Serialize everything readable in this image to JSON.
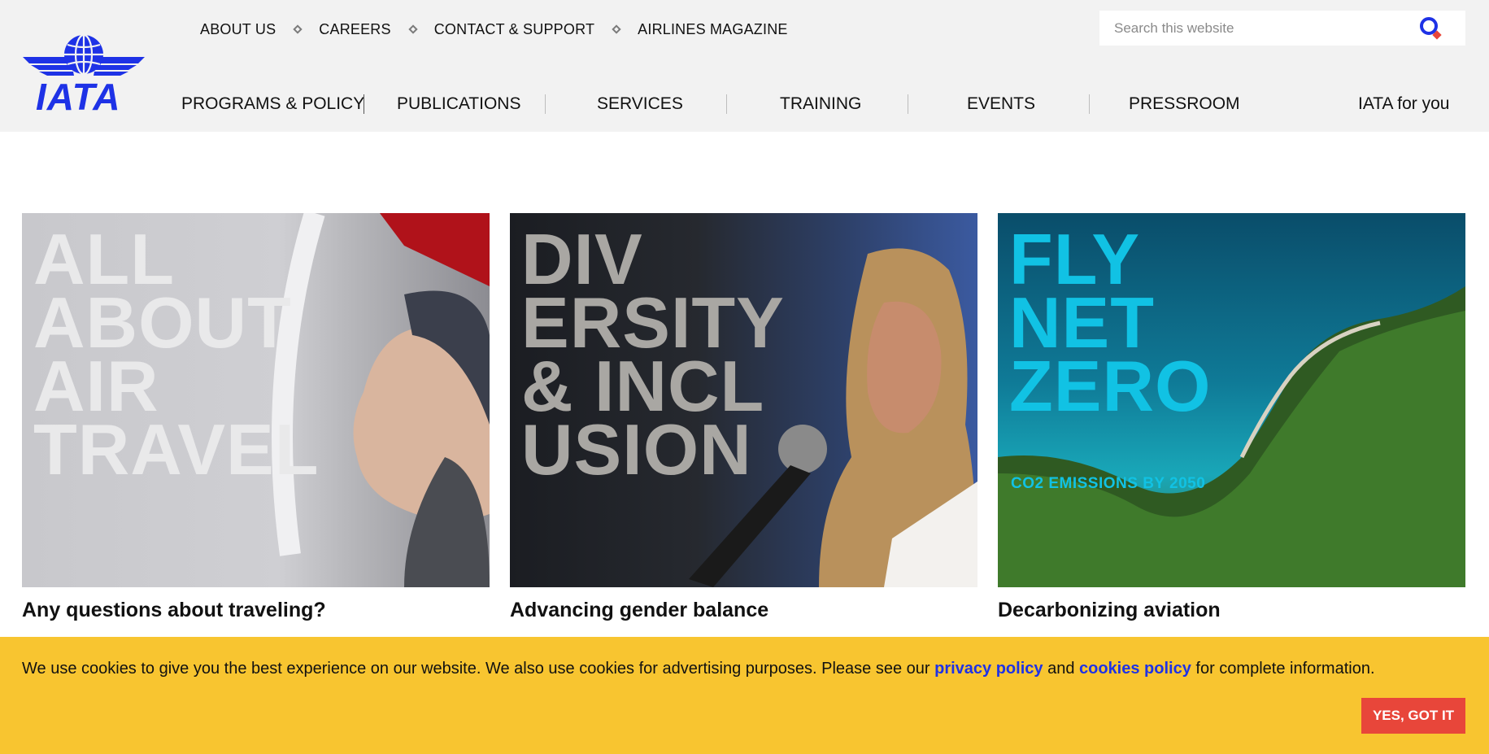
{
  "logo": {
    "text": "IATA"
  },
  "util_nav": {
    "items": [
      {
        "label": "ABOUT US"
      },
      {
        "label": "CAREERS"
      },
      {
        "label": "CONTACT & SUPPORT"
      },
      {
        "label": "AIRLINES MAGAZINE"
      }
    ]
  },
  "search": {
    "placeholder": "Search this website",
    "value": "",
    "icon": "search-icon"
  },
  "main_nav": {
    "items": [
      {
        "label": "PROGRAMS & POLICY"
      },
      {
        "label": "PUBLICATIONS"
      },
      {
        "label": "SERVICES"
      },
      {
        "label": "TRAINING"
      },
      {
        "label": "EVENTS"
      },
      {
        "label": "PRESSROOM"
      },
      {
        "label": "IATA for you"
      }
    ]
  },
  "cards": [
    {
      "image_text": "ALL\nABOUT\nAIR\nTRAVEL",
      "title": "Any questions about traveling?"
    },
    {
      "image_text": "DIV\nERSITY\n& INCL\nUSION",
      "title": "Advancing gender balance"
    },
    {
      "image_text": "FLY\nNET\nZERO",
      "image_subtext": "CO2 EMISSIONS BY 2050",
      "title": "Decarbonizing aviation"
    }
  ],
  "cookie_banner": {
    "text_before": "We use cookies to give you the best experience on our website. We also use cookies for advertising purposes. Please see our ",
    "privacy_link": "privacy policy",
    "text_middle": " and ",
    "cookies_link": "cookies policy",
    "text_after": " for complete information.",
    "accept_label": "YES, GOT IT"
  },
  "colors": {
    "brand_blue": "#1e32e6",
    "header_bg": "#f2f2f2",
    "banner_yellow": "#f8c530",
    "button_red": "#e8463a",
    "net_zero_cyan": "#11c2e4"
  }
}
